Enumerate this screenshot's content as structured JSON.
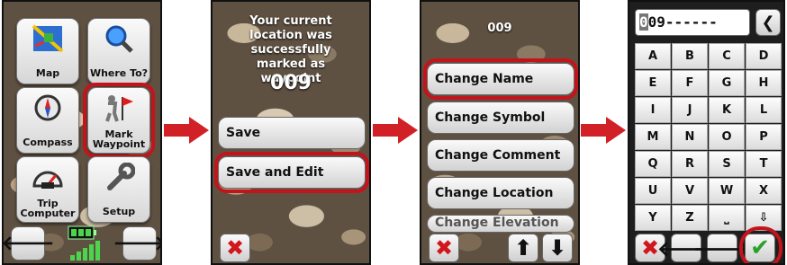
{
  "screen1": {
    "tiles": [
      {
        "label": "Map",
        "icon": "map-icon"
      },
      {
        "label": "Where To?",
        "icon": "magnifier-icon"
      },
      {
        "label": "Compass",
        "icon": "compass-icon"
      },
      {
        "label": "Mark Waypoint",
        "icon": "flag-person-icon"
      },
      {
        "label": "Trip Computer",
        "icon": "speedometer-icon"
      },
      {
        "label": "Setup",
        "icon": "wrench-icon"
      }
    ],
    "nav_left": "🡐",
    "nav_right": "🡒"
  },
  "screen2": {
    "message": "Your current location was successfully marked as waypoint",
    "waypoint": "009",
    "buttons": [
      "Save",
      "Save and Edit"
    ],
    "cancel": "✖"
  },
  "screen3": {
    "title": "009",
    "items": [
      "Change Name",
      "Change Symbol",
      "Change Comment",
      "Change Location",
      "Change Elevation"
    ],
    "cancel": "✖",
    "up": "⬆",
    "down": "⬇"
  },
  "screen4": {
    "field_cursor": "0",
    "field_value": "09------",
    "backspace": "❮",
    "keys": [
      "A",
      "B",
      "C",
      "D",
      "E",
      "F",
      "G",
      "H",
      "I",
      "J",
      "K",
      "L",
      "M",
      "N",
      "O",
      "P",
      "Q",
      "R",
      "S",
      "T",
      "U",
      "V",
      "W",
      "X",
      "Y",
      "Z",
      "⎵",
      "⇩"
    ],
    "cancel": "✖",
    "left": "🡐",
    "right": "🡒",
    "ok": "✔"
  },
  "colors": {
    "highlight": "#c3141c",
    "arrow": "#d12026",
    "ok": "#2aa12a"
  }
}
